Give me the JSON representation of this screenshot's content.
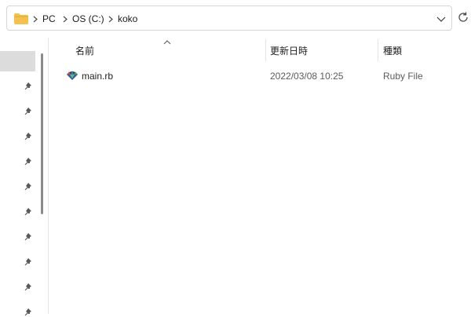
{
  "address_bar": {
    "folder_icon": "folder-icon",
    "breadcrumb": [
      "PC",
      "OS (C:)",
      "koko"
    ],
    "separator_icon": "chevron-right-icon",
    "dropdown_icon": "chevron-down-icon",
    "refresh_icon": "refresh-icon"
  },
  "nav_pane": {
    "pin_icon": "pin-icon",
    "pinned_count": 10
  },
  "columns": [
    {
      "label": "名前",
      "sorted": "ascending"
    },
    {
      "label": "更新日時"
    },
    {
      "label": "種類"
    }
  ],
  "files": [
    {
      "icon": "ruby-file-icon",
      "name": "main.rb",
      "modified": "2022/03/08 10:25",
      "type": "Ruby File"
    }
  ],
  "colors": {
    "folder": "#f2c14e",
    "selection": "#dcdcdc"
  }
}
